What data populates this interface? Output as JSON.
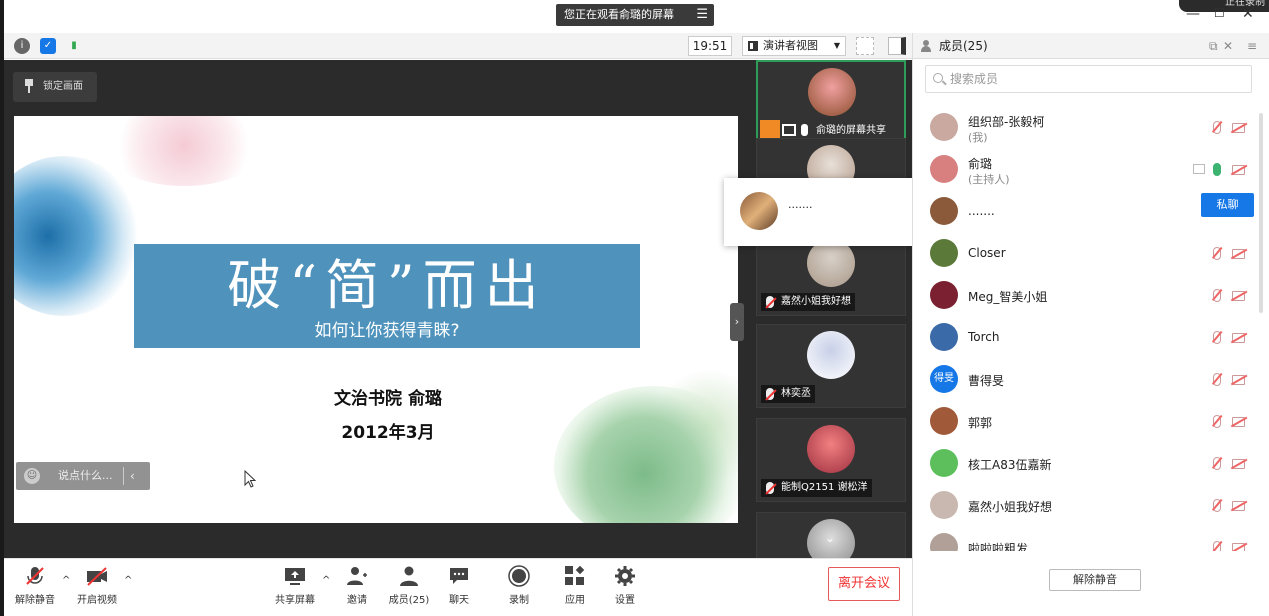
{
  "banner": {
    "text": "您正在观看俞璐的屏幕",
    "menu_icon": "menu-icon"
  },
  "window": {
    "min": "—",
    "max": "☐",
    "close": "✕",
    "record_badge": "正在录制"
  },
  "infobar": {
    "time": "19:51",
    "view_mode": "演讲者视图"
  },
  "main": {
    "lock_label": "锁定画面",
    "slide": {
      "title": "破“简”而出",
      "subtitle": "如何让你获得青睐?",
      "author": "文治书院 俞璐",
      "date": "2012年3月"
    },
    "chat_placeholder": "说点什么...",
    "collapse_arrow": "›"
  },
  "video_tiles": [
    {
      "name": "俞璐的屏幕共享",
      "colors": [
        "#f0a0a0",
        "#8b4d2c"
      ]
    },
    {
      "name": "",
      "colors": [
        "#e8e0d8",
        "#b39a8a"
      ]
    },
    {
      "name": "嘉然小姐我好想",
      "colors": [
        "#d8d0c8",
        "#a89888"
      ]
    },
    {
      "name": "林奕丞",
      "colors": [
        "#c8d0e8",
        "#ffffff"
      ]
    },
    {
      "name": "能制Q2151 谢松洋",
      "colors": [
        "#f08080",
        "#a03040"
      ]
    },
    {
      "name": "",
      "colors": [
        "#dddddd",
        "#888888"
      ]
    }
  ],
  "popup": {
    "name": "......."
  },
  "toolbar": {
    "unmute": "解除静音",
    "start_video": "开启视频",
    "share_screen": "共享屏幕",
    "invite": "邀请",
    "members": "成员(25)",
    "chat": "聊天",
    "record": "录制",
    "apps": "应用",
    "settings": "设置",
    "leave": "离开会议"
  },
  "panel": {
    "title": "成员(25)",
    "search_placeholder": "搜索成员",
    "private_chat": "私聊",
    "unmute_all": "解除静音",
    "members": [
      {
        "name": "组织部-张毅柯",
        "sub": "(我)",
        "avatar": "#c9a9a0"
      },
      {
        "name": "俞璐",
        "sub": "(主持人)",
        "avatar": "#d88080"
      },
      {
        "name": ".......",
        "sub": "",
        "avatar": "#8a5a3a"
      },
      {
        "name": "Closer",
        "sub": "",
        "avatar": "#5b7a3a"
      },
      {
        "name": "Meg_智美小姐",
        "sub": "",
        "avatar": "#7a2030"
      },
      {
        "name": "Torch",
        "sub": "",
        "avatar": "#3a6aa8"
      },
      {
        "name": "曹得旻",
        "sub": "",
        "avatar": "#1677e6",
        "initials": "得旻"
      },
      {
        "name": "郭郭",
        "sub": "",
        "avatar": "#a05a3a"
      },
      {
        "name": "核工A83伍嘉新",
        "sub": "",
        "avatar": "#5cbf5c"
      },
      {
        "name": "嘉然小姐我好想",
        "sub": "",
        "avatar": "#c8b8b0"
      },
      {
        "name": "啦啦啦粗发",
        "sub": "",
        "avatar": "#b0a098"
      }
    ]
  }
}
